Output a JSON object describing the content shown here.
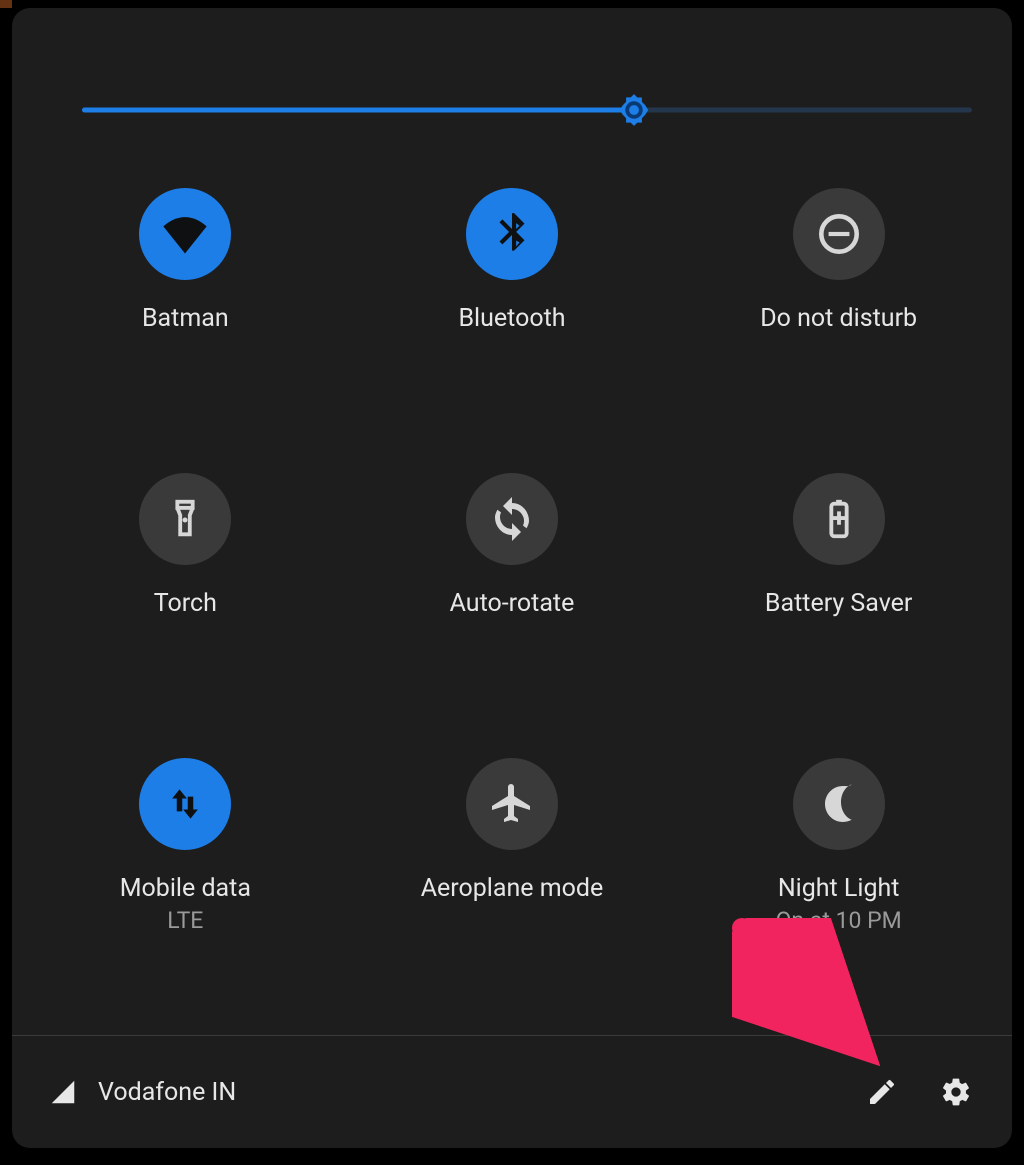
{
  "colors": {
    "accent": "#1d7ee8",
    "tile_inactive": "#3a3a3a",
    "panel_bg": "#1d1d1d",
    "text": "#e7e7e7",
    "subtext": "#9a9a9a",
    "annotation_arrow": "#f2245f"
  },
  "brightness": {
    "percent": 62
  },
  "tiles": [
    {
      "id": "wifi",
      "icon": "wifi-icon",
      "active": true,
      "label": "Batman",
      "sub": ""
    },
    {
      "id": "bluetooth",
      "icon": "bluetooth-icon",
      "active": true,
      "label": "Bluetooth",
      "sub": ""
    },
    {
      "id": "dnd",
      "icon": "dnd-icon",
      "active": false,
      "label": "Do not disturb",
      "sub": ""
    },
    {
      "id": "torch",
      "icon": "torch-icon",
      "active": false,
      "label": "Torch",
      "sub": ""
    },
    {
      "id": "autorotate",
      "icon": "autorotate-icon",
      "active": false,
      "label": "Auto-rotate",
      "sub": ""
    },
    {
      "id": "battery-saver",
      "icon": "battery-icon",
      "active": false,
      "label": "Battery Saver",
      "sub": ""
    },
    {
      "id": "mobile-data",
      "icon": "mobiledata-icon",
      "active": true,
      "label": "Mobile data",
      "sub": "LTE"
    },
    {
      "id": "aeroplane-mode",
      "icon": "airplane-icon",
      "active": false,
      "label": "Aeroplane mode",
      "sub": ""
    },
    {
      "id": "night-light",
      "icon": "nightlight-icon",
      "active": false,
      "label": "Night Light",
      "sub": "On at 10 PM"
    }
  ],
  "footer": {
    "carrier": "Vodafone IN",
    "edit_button": "edit",
    "settings_button": "settings"
  }
}
